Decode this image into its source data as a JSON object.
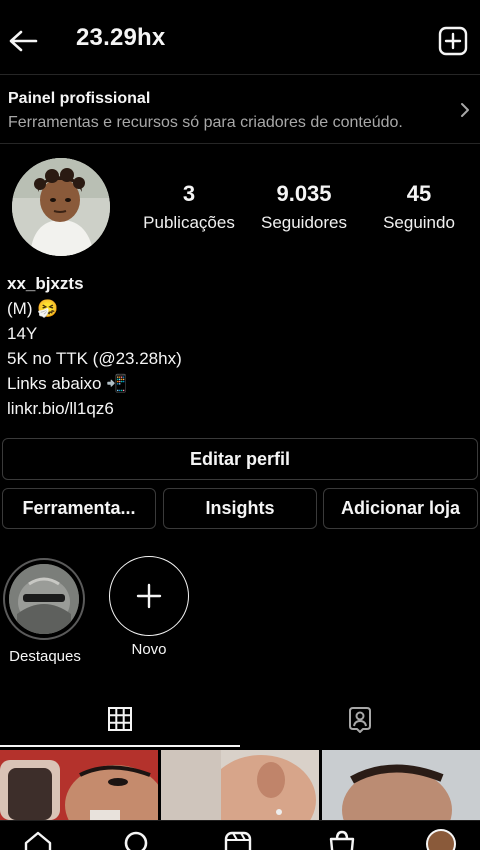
{
  "header": {
    "title": "23.29hx"
  },
  "pro_panel": {
    "title": "Painel profissional",
    "subtitle": "Ferramentas e recursos só para criadores de conteúdo."
  },
  "stats": [
    {
      "value": "3",
      "label": "Publicações"
    },
    {
      "value": "9.035",
      "label": "Seguidores"
    },
    {
      "value": "45",
      "label": "Seguindo"
    }
  ],
  "bio": {
    "name": "xx_bjxzts",
    "lines": [
      "(M) 🤧",
      "14Y",
      "5K no TTK (@23.28hx)",
      "Links abaixo 📲"
    ],
    "link": "linkr.bio/ll1qz6"
  },
  "buttons": {
    "edit_profile": "Editar perfil",
    "tools": "Ferramenta...",
    "insights": "Insights",
    "add_shop": "Adicionar loja"
  },
  "highlights": [
    {
      "label": "Destaques"
    },
    {
      "label": "Novo"
    }
  ],
  "tabs": {
    "active": "grid"
  },
  "icons": {
    "back": "arrow-left-icon",
    "new_post": "plus-square-icon",
    "chevron": "chevron-right-icon",
    "add_highlight": "plus-icon",
    "grid": "grid-icon",
    "tagged": "tagged-user-icon"
  },
  "colors": {
    "background": "#000000",
    "text": "#f5f5f5",
    "muted": "#a8a8a8",
    "border": "#3a3a3a"
  }
}
